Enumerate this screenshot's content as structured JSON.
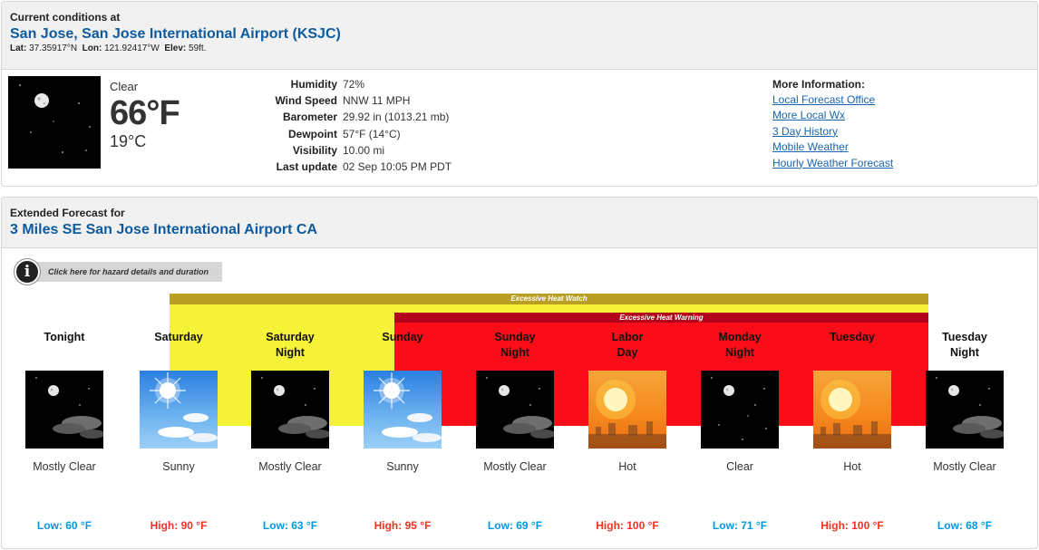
{
  "current": {
    "header_small": "Current conditions at",
    "station": "San Jose, San Jose International Airport (KSJC)",
    "lat_label": "Lat:",
    "lat": "37.35917°N",
    "lon_label": "Lon:",
    "lon": "121.92417°W",
    "elev_label": "Elev:",
    "elev": "59ft.",
    "condition": "Clear",
    "temp_f": "66°F",
    "temp_c": "19°C",
    "details": [
      {
        "label": "Humidity",
        "value": "72%"
      },
      {
        "label": "Wind Speed",
        "value": "NNW 11 MPH"
      },
      {
        "label": "Barometer",
        "value": "29.92 in (1013.21 mb)"
      },
      {
        "label": "Dewpoint",
        "value": "57°F (14°C)"
      },
      {
        "label": "Visibility",
        "value": "10.00 mi"
      },
      {
        "label": "Last update",
        "value": "02 Sep 10:05 PM PDT"
      }
    ],
    "more_info_title": "More Information:",
    "links": [
      "Local Forecast Office",
      "More Local Wx",
      "3 Day History",
      "Mobile Weather",
      "Hourly Weather Forecast"
    ]
  },
  "forecast": {
    "header_small": "Extended Forecast for",
    "location": "3 Miles SE San Jose International Airport CA",
    "hazard_button": "Click here for hazard details and duration",
    "hazard_icon_glyph": "i",
    "watch_label": "Excessive Heat Watch",
    "warning_label": "Excessive Heat Warning",
    "watch_color": "#f5f238",
    "warning_color": "#fa0d18",
    "periods": [
      {
        "name1": "Tonight",
        "name2": "",
        "icon": "moon-clouds-icon",
        "desc": "Mostly Clear",
        "temp": "Low: 60 °F",
        "kind": "low"
      },
      {
        "name1": "Saturday",
        "name2": "",
        "icon": "sun-clouds-icon",
        "desc": "Sunny",
        "temp": "High: 90 °F",
        "kind": "high"
      },
      {
        "name1": "Saturday",
        "name2": "Night",
        "icon": "moon-clouds-icon",
        "desc": "Mostly Clear",
        "temp": "Low: 63 °F",
        "kind": "low"
      },
      {
        "name1": "Sunday",
        "name2": "",
        "icon": "sun-clouds-icon",
        "desc": "Sunny",
        "temp": "High: 95 °F",
        "kind": "high"
      },
      {
        "name1": "Sunday",
        "name2": "Night",
        "icon": "moon-clouds-icon",
        "desc": "Mostly Clear",
        "temp": "Low: 69 °F",
        "kind": "low"
      },
      {
        "name1": "Labor",
        "name2": "Day",
        "icon": "hot-sun-icon",
        "desc": "Hot",
        "temp": "High: 100 °F",
        "kind": "high"
      },
      {
        "name1": "Monday",
        "name2": "Night",
        "icon": "moon-clear-icon",
        "desc": "Clear",
        "temp": "Low: 71 °F",
        "kind": "low"
      },
      {
        "name1": "Tuesday",
        "name2": "",
        "icon": "hot-sun-icon",
        "desc": "Hot",
        "temp": "High: 100 °F",
        "kind": "high"
      },
      {
        "name1": "Tuesday",
        "name2": "Night",
        "icon": "moon-clouds-icon",
        "desc": "Mostly Clear",
        "temp": "Low: 68 °F",
        "kind": "low"
      }
    ]
  }
}
